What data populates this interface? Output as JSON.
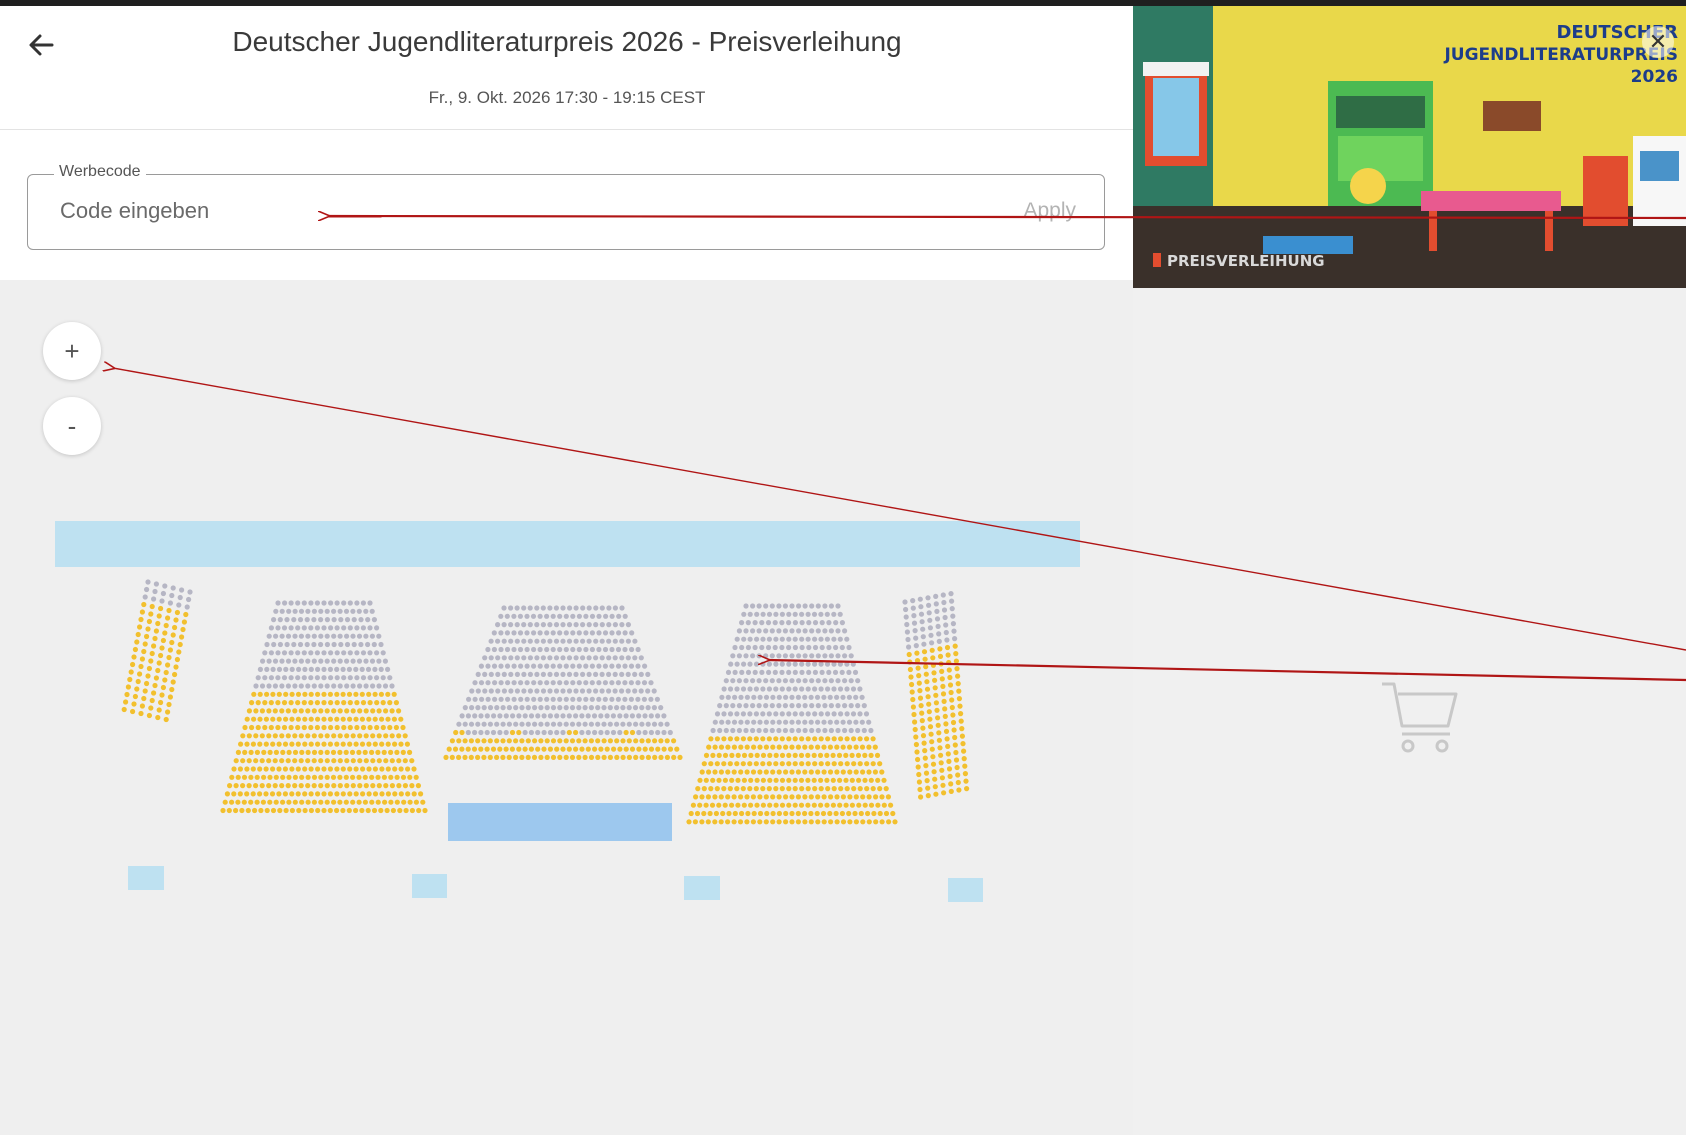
{
  "header": {
    "title": "Deutscher Jugendliteraturpreis 2026 - Preisverleihung",
    "date": "Fr., 9. Okt. 2026 17:30 - 19:15 CEST"
  },
  "promo": {
    "legend": "Werbecode",
    "placeholder": "Code eingeben",
    "apply_label": "Apply"
  },
  "zoom": {
    "in_label": "+",
    "out_label": "-"
  },
  "banner": {
    "line1": "DEUTSCHER",
    "line2": "JUGENDLITERATURPREIS",
    "year": "2026",
    "caption": "PREISVERLEIHUNG"
  },
  "icons": {
    "back": "arrow-left-icon",
    "cart": "cart-icon",
    "close": "close-icon"
  },
  "colors": {
    "available_seat": "#F2C02E",
    "unavailable_seat": "#B6B6C4",
    "stage": "#BEE1F1",
    "block": "#9DC8EE",
    "annotation": "#B01515"
  }
}
